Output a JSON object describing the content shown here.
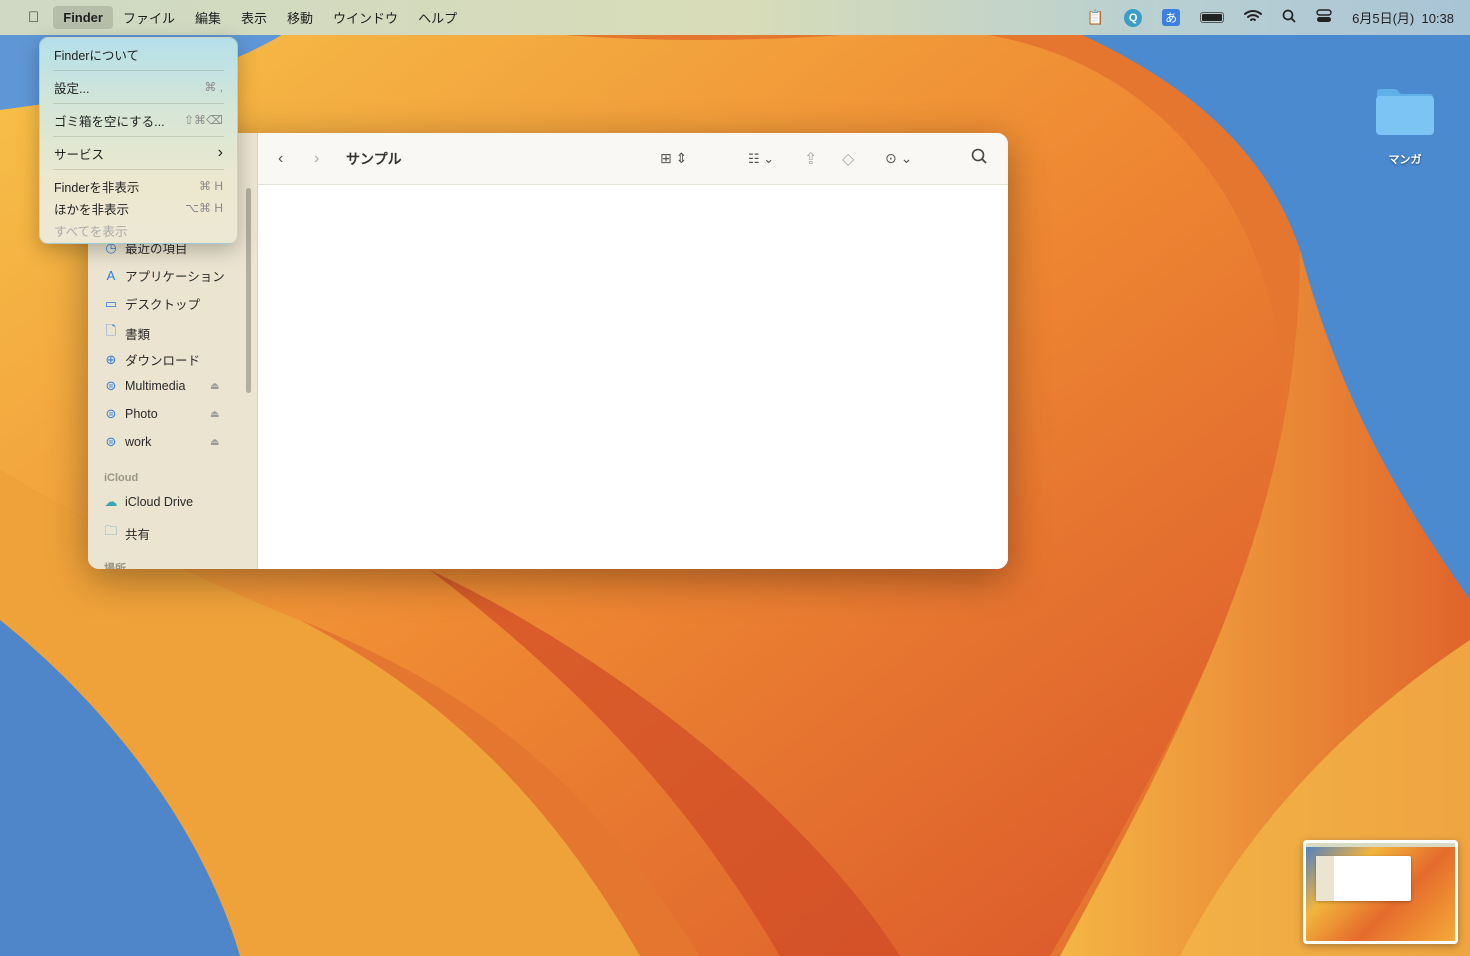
{
  "menubar": {
    "apple": "",
    "items": [
      "Finder",
      "ファイル",
      "編集",
      "表示",
      "移動",
      "ウインドウ",
      "ヘルプ"
    ],
    "active": "Finder",
    "status_icons": [
      "clipboard-icon",
      "search-app-icon",
      "input-method-icon",
      "battery-icon",
      "wifi-icon",
      "spotlight-icon",
      "control-center-icon"
    ],
    "input_method": "あ",
    "datetime": "6月5日(月)  10:38"
  },
  "finder_menu": {
    "items": [
      {
        "label": "Finderについて",
        "shortcut": ""
      },
      {
        "label": "設定...",
        "shortcut": "⌘ ,"
      },
      {
        "label": "ゴミ箱を空にする...",
        "shortcut": "⇧⌘⌫"
      },
      {
        "label": "サービス",
        "shortcut": "›"
      },
      {
        "label": "Finderを非表示",
        "shortcut": "⌘ H"
      },
      {
        "label": "ほかを非表示",
        "shortcut": "⌥⌘ H"
      },
      {
        "label": "すべてを表示",
        "shortcut": ""
      }
    ]
  },
  "window": {
    "title": "サンプル",
    "sidebar": {
      "items": [
        {
          "label": "最近の項目",
          "icon": "clock-icon"
        },
        {
          "label": "アプリケーション",
          "icon": "apps-icon"
        },
        {
          "label": "デスクトップ",
          "icon": "desktop-icon"
        },
        {
          "label": "書類",
          "icon": "document-icon"
        },
        {
          "label": "ダウンロード",
          "icon": "download-icon"
        },
        {
          "label": "Multimedia",
          "icon": "network-drive-icon"
        },
        {
          "label": "Photo",
          "icon": "network-drive-icon"
        },
        {
          "label": "work",
          "icon": "network-drive-icon"
        }
      ],
      "icloud_header": "iCloud",
      "icloud_items": [
        {
          "label": "iCloud Drive",
          "icon": "cloud-icon"
        },
        {
          "label": "共有",
          "icon": "shared-folder-icon"
        }
      ],
      "locations_header": "場所"
    }
  },
  "desktop": {
    "folder_label": "マンガ"
  },
  "colors": {
    "accent": "#2f7be0"
  }
}
